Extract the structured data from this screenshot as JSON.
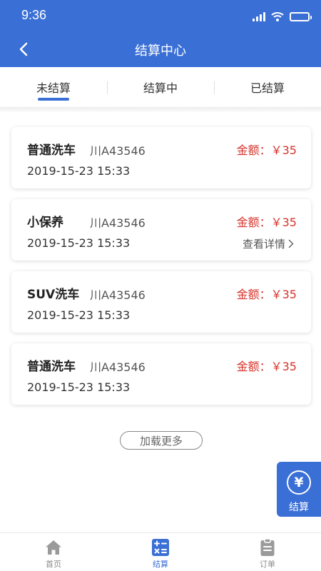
{
  "status_bar": {
    "time": "9:36"
  },
  "header": {
    "title": "结算中心"
  },
  "tabs": [
    {
      "label": "未结算",
      "active": true
    },
    {
      "label": "结算中",
      "active": false
    },
    {
      "label": "已结算",
      "active": false
    }
  ],
  "cards": [
    {
      "name": "普通洗车",
      "plate": "川A43546",
      "amount": "金额：￥35",
      "time": "2019-15-23 15:33",
      "detail": ""
    },
    {
      "name": "小保养",
      "plate": "川A43546",
      "amount": "金额：￥35",
      "time": "2019-15-23 15:33",
      "detail": "查看详情"
    },
    {
      "name": "SUV洗车",
      "plate": "川A43546",
      "amount": "金额：￥35",
      "time": "2019-15-23 15:33",
      "detail": ""
    },
    {
      "name": "普通洗车",
      "plate": "川A43546",
      "amount": "金额：￥35",
      "time": "2019-15-23 15:33",
      "detail": ""
    }
  ],
  "load_more": "加载更多",
  "settle_button": {
    "symbol": "¥",
    "label": "结算"
  },
  "bottom_nav": [
    {
      "label": "首页",
      "icon": "home-icon",
      "active": false
    },
    {
      "label": "结算",
      "icon": "calculator-icon",
      "active": true
    },
    {
      "label": "订单",
      "icon": "clipboard-icon",
      "active": false
    }
  ],
  "colors": {
    "primary": "#3a6fd6",
    "amount": "#d6332c"
  }
}
